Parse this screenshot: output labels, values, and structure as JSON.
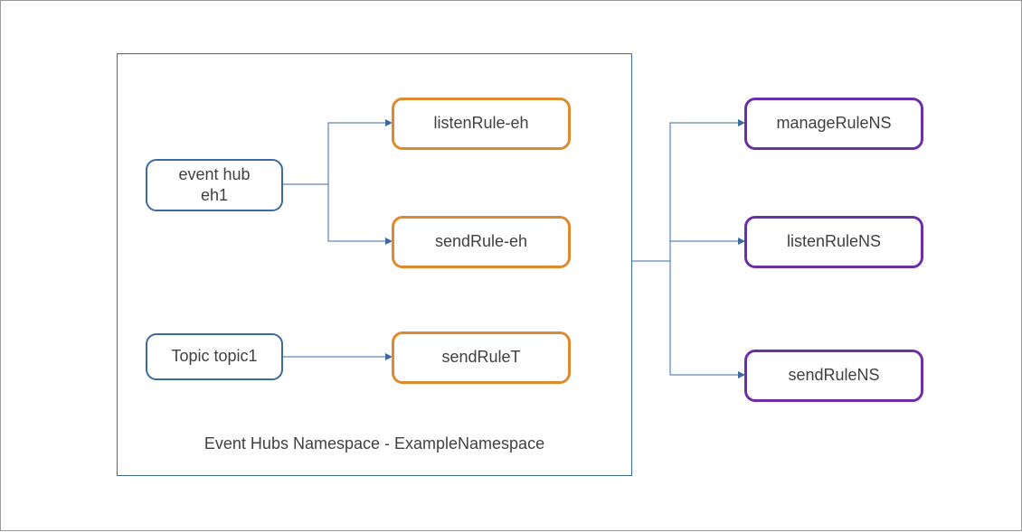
{
  "namespace": {
    "caption": "Event Hubs Namespace - ExampleNamespace"
  },
  "entities": {
    "eventHub": {
      "line1": "event hub",
      "line2": "eh1"
    },
    "topic": {
      "label": "Topic topic1"
    }
  },
  "rules": {
    "listenEh": "listenRule-eh",
    "sendEh": "sendRule-eh",
    "sendT": "sendRuleT"
  },
  "nsRules": {
    "manage": "manageRuleNS",
    "listen": "listenRuleNS",
    "send": "sendRuleNS"
  },
  "colors": {
    "blue": "#3b6aa0",
    "orange": "#e08a2e",
    "purple": "#6b2fa8"
  }
}
